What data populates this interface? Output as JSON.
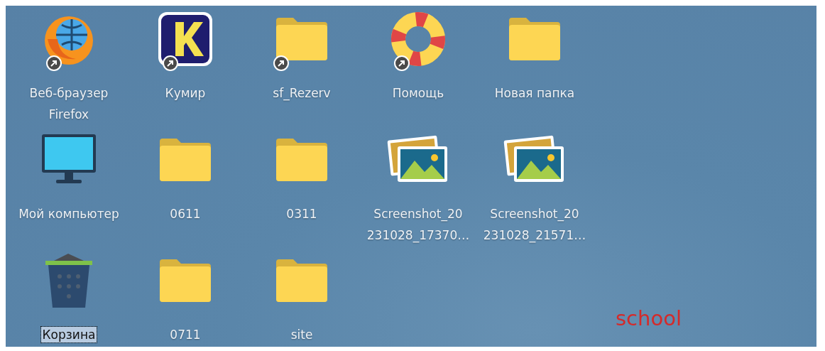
{
  "desktop": {
    "icons": [
      {
        "kind": "browser",
        "label": "Веб-браузер Firefox",
        "shortcut": true,
        "selected": false
      },
      {
        "kind": "kumir",
        "label": "Кумир",
        "shortcut": true,
        "selected": false
      },
      {
        "kind": "folder",
        "label": "sf_Rezerv",
        "shortcut": true,
        "selected": false
      },
      {
        "kind": "help",
        "label": "Помощь",
        "shortcut": true,
        "selected": false
      },
      {
        "kind": "folder",
        "label": "Новая папка",
        "shortcut": false,
        "selected": false
      },
      {
        "kind": "computer",
        "label": "Мой компьютер",
        "shortcut": false,
        "selected": false
      },
      {
        "kind": "folder",
        "label": "0611",
        "shortcut": false,
        "selected": false
      },
      {
        "kind": "folder",
        "label": "0311",
        "shortcut": false,
        "selected": false
      },
      {
        "kind": "image",
        "label": "Screenshot_20 231028_17370…",
        "shortcut": false,
        "selected": false
      },
      {
        "kind": "image",
        "label": "Screenshot_20 231028_21571…",
        "shortcut": false,
        "selected": false
      },
      {
        "kind": "trash",
        "label": "Корзина",
        "shortcut": false,
        "selected": true
      },
      {
        "kind": "folder",
        "label": "0711",
        "shortcut": false,
        "selected": false
      },
      {
        "kind": "folder",
        "label": "site",
        "shortcut": false,
        "selected": false
      }
    ],
    "note": {
      "text": "school",
      "color": "#d42a2a"
    }
  }
}
